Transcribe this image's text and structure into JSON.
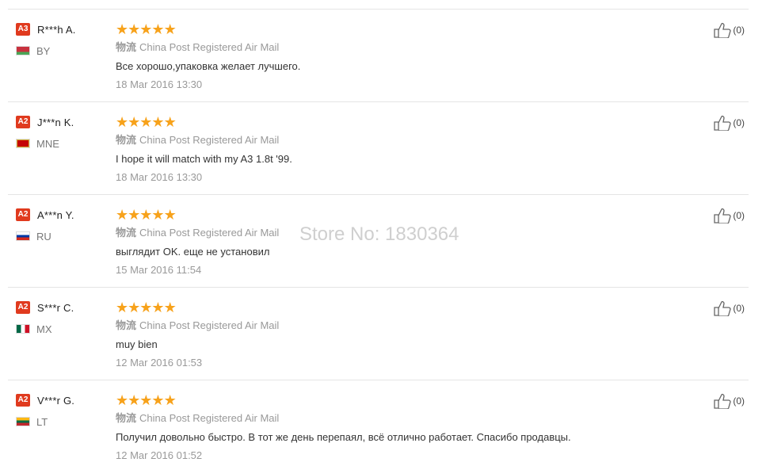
{
  "reviews": [
    {
      "level": "A3",
      "user": "R***h A.",
      "country": "BY",
      "flag_colors": [
        "#c8313e",
        "#c8313e",
        "#4aa657"
      ],
      "stars": 5,
      "logistics_cn": "物流",
      "logistics": "China Post Registered Air Mail",
      "feedback": "Все хорошо,упаковка желает лучшего.",
      "date": "18 Mar 2016 13:30",
      "helpful": "(0)"
    },
    {
      "level": "A2",
      "user": "J***n K.",
      "country": "MNE",
      "flag_colors": [
        "#c40308",
        "#c40308",
        "#c40308"
      ],
      "stars": 5,
      "logistics_cn": "物流",
      "logistics": "China Post Registered Air Mail",
      "feedback": "I hope it will match with my A3 1.8t '99.",
      "date": "18 Mar 2016 13:30",
      "helpful": "(0)"
    },
    {
      "level": "A2",
      "user": "A***n Y.",
      "country": "RU",
      "flag_colors": [
        "#ffffff",
        "#0039a6",
        "#d52b1e"
      ],
      "stars": 5,
      "logistics_cn": "物流",
      "logistics": "China Post Registered Air Mail",
      "feedback": "выглядит OK. еще не установил",
      "date": "15 Mar 2016 11:54",
      "helpful": "(0)"
    },
    {
      "level": "A2",
      "user": "S***r C.",
      "country": "MX",
      "flag_colors": [
        "#006847",
        "#ffffff",
        "#ce1126"
      ],
      "stars": 5,
      "logistics_cn": "物流",
      "logistics": "China Post Registered Air Mail",
      "feedback": "muy bien",
      "date": "12 Mar 2016 01:53",
      "helpful": "(0)"
    },
    {
      "level": "A2",
      "user": "V***r G.",
      "country": "LT",
      "flag_colors": [
        "#fdb913",
        "#006a44",
        "#c1272d"
      ],
      "stars": 5,
      "logistics_cn": "物流",
      "logistics": "China Post Registered Air Mail",
      "feedback": "Получил довольно быстро. В тот же день перепаял, всё отлично работает. Спасибо продавцы.",
      "date": "12 Mar 2016 01:52",
      "helpful": "(0)"
    }
  ],
  "watermark": "Store No: 1830364",
  "colors": {
    "star": "#f7a21b",
    "badge": "#e03a1e"
  },
  "icons": {
    "helpful": "thumbs-up-icon",
    "star": "star-icon"
  }
}
